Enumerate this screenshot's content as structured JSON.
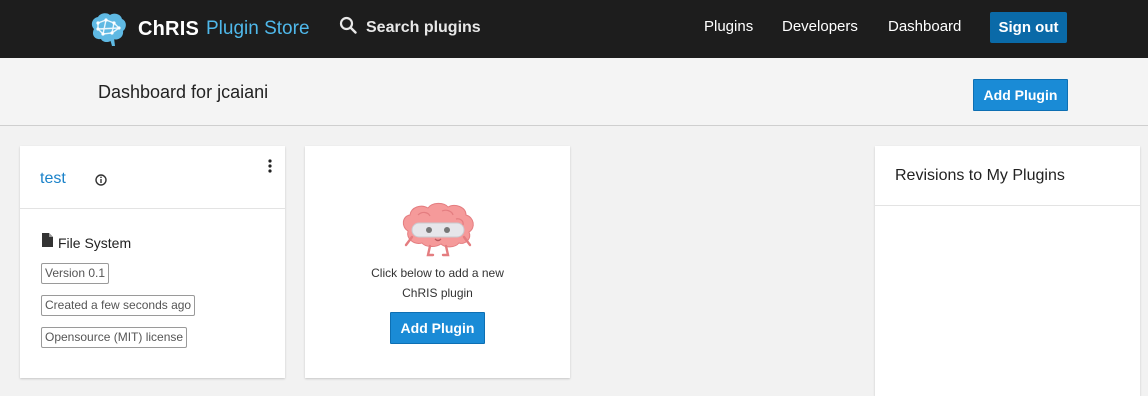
{
  "navbar": {
    "brand_name": "ChRIS",
    "brand_sub": "Plugin Store",
    "search_label": "Search plugins",
    "links": [
      "Plugins",
      "Developers",
      "Dashboard"
    ],
    "signout_label": "Sign out"
  },
  "subheader": {
    "title": "Dashboard for jcaiani",
    "add_plugin_label": "Add Plugin"
  },
  "plugin_card": {
    "name": "test",
    "category": "File System",
    "badges": [
      "Version 0.1",
      "Created a few seconds ago",
      "Opensource (MIT) license"
    ]
  },
  "empty_card": {
    "line1": "Click below to add a new",
    "line2": "ChRIS plugin",
    "add_plugin_label": "Add Plugin"
  },
  "revisions": {
    "title": "Revisions to My Plugins"
  },
  "colors": {
    "navbar_bg": "#1d1d1d",
    "accent": "#1a8bd6",
    "signout_bg": "#0a6aa8",
    "link": "#1a82c9",
    "brand_sub": "#4fb8ea"
  },
  "icons": [
    "brain-logo-icon",
    "search-icon",
    "info-icon",
    "kebab-menu-icon",
    "file-icon",
    "brain-mascot-icon"
  ]
}
